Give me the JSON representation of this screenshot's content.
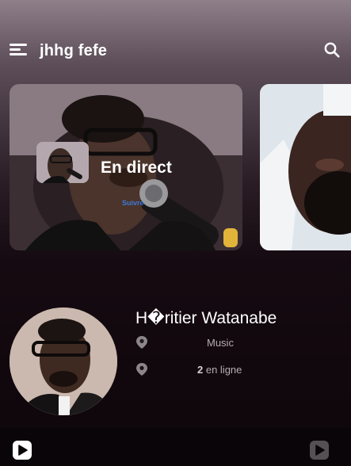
{
  "header": {
    "title": "jhhg fefe",
    "menu_icon": "menu-icon",
    "search_icon": "search-icon"
  },
  "carousel": {
    "items": [
      {
        "label": "En direct",
        "sub_label": "Suivre"
      },
      {
        "label": ""
      }
    ]
  },
  "artist": {
    "name": "H�ritier Watanabe",
    "genre": "Music",
    "online_count": "2",
    "online_suffix": " en ligne",
    "location_icon": "map-pin-icon"
  },
  "bottom_bar": {
    "left_icon": "play-icon",
    "right_icon": "play-icon"
  },
  "colors": {
    "accent_link": "#3f78d6",
    "background_top": "#8e7f89",
    "background_bottom": "#0d060a"
  }
}
